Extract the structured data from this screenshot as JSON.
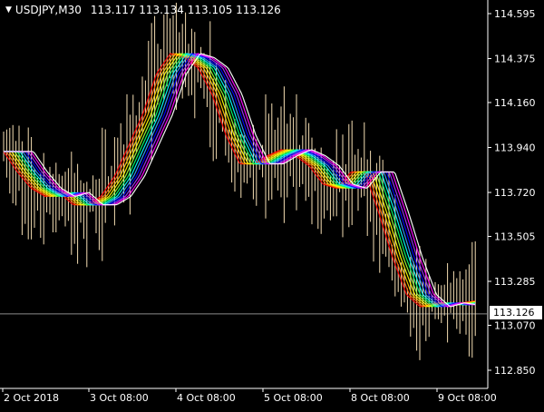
{
  "header": {
    "symbol": "USDJPY,M30",
    "ohlc": "113.117 113.134 113.105 113.126",
    "menu_icon": "triangle-down-icon"
  },
  "price_axis": {
    "labels": [
      "114.595",
      "114.375",
      "114.160",
      "113.940",
      "113.720",
      "113.505",
      "113.285",
      "113.070",
      "112.850"
    ]
  },
  "time_axis": {
    "labels": [
      "2 Oct 2018",
      "3 Oct 08:00",
      "4 Oct 08:00",
      "5 Oct 08:00",
      "8 Oct 08:00",
      "9 Oct 08:00"
    ]
  },
  "current_price": "113.126",
  "colors": {
    "background": "#000000",
    "candles": "#f5deb3",
    "axis": "#ffffff",
    "ribbon": [
      "#ff0000",
      "#ff6600",
      "#ffcc00",
      "#ffff00",
      "#99ff33",
      "#00ff66",
      "#00ffff",
      "#3399ff",
      "#0000ff",
      "#9933ff",
      "#ff00ff",
      "#ffffff"
    ]
  },
  "chart_data": {
    "type": "line",
    "title": "USDJPY,M30",
    "y_ticks": [
      114.595,
      114.375,
      114.16,
      113.94,
      113.72,
      113.505,
      113.285,
      113.07,
      112.85
    ],
    "ylim": [
      112.8,
      114.62
    ],
    "x_ticks": [
      "2 Oct 2018",
      "3 Oct 08:00",
      "4 Oct 08:00",
      "5 Oct 08:00",
      "8 Oct 08:00",
      "9 Oct 08:00"
    ],
    "ribbon_center": [
      113.92,
      113.82,
      113.74,
      113.7,
      113.72,
      113.66,
      113.66,
      113.7,
      113.8,
      113.95,
      114.1,
      114.3,
      114.4,
      114.38,
      114.33,
      114.2,
      114.0,
      113.86,
      113.86,
      113.9,
      113.93,
      113.9,
      113.85,
      113.76,
      113.74,
      113.82,
      113.82,
      113.62,
      113.4,
      113.22,
      113.16,
      113.18,
      113.17,
      113.18,
      113.19
    ],
    "current_price": 113.126
  }
}
